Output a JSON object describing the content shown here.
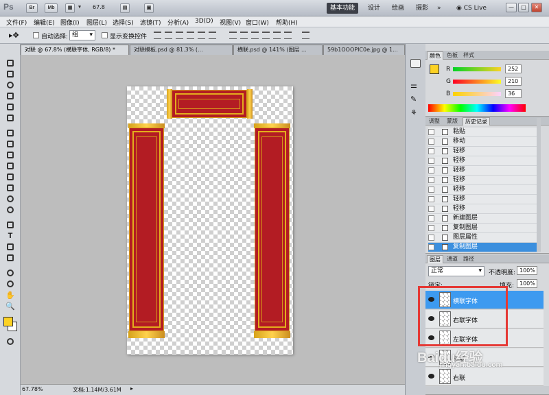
{
  "app": {
    "logo": "Ps",
    "buttons": [
      "Br",
      "Mb"
    ],
    "zoom": "67.8",
    "workspaces": [
      "基本功能",
      "设计",
      "绘画",
      "摄影"
    ],
    "active_workspace": "基本功能",
    "more": "»",
    "cs_live": "CS Live",
    "window_controls": [
      "—",
      "□",
      "✕"
    ]
  },
  "menu": [
    "文件(F)",
    "编辑(E)",
    "图像(I)",
    "图层(L)",
    "选择(S)",
    "滤镜(T)",
    "分析(A)",
    "3D(D)",
    "视图(V)",
    "窗口(W)",
    "帮助(H)"
  ],
  "options": {
    "auto_select_label": "自动选择:",
    "auto_select_value": "组",
    "show_transform_label": "显示变换控件"
  },
  "tabs": [
    "对联 @ 67.8% (横联字体, RGB/8) *",
    "对联模板.psd @ 81.3% (...",
    "横联.psd @ 141% (图层 ...",
    "59b1OOOPIC0e.jpg @ 1..."
  ],
  "status": {
    "zoom": "67.78%",
    "doc": "文档:1.14M/3.61M"
  },
  "color_panel": {
    "tabs": [
      "颜色",
      "色板",
      "样式"
    ],
    "r_label": "R",
    "r_value": "252",
    "g_label": "G",
    "g_value": "210",
    "b_label": "B",
    "b_value": "36",
    "foreground": "#fcd224",
    "r": 0.988,
    "g": 0.824,
    "b": 0.141
  },
  "history_panel": {
    "tabs": [
      "调整",
      "蒙版",
      "历史记录"
    ],
    "items": [
      "粘贴",
      "移动",
      "轻移",
      "轻移",
      "轻移",
      "轻移",
      "轻移",
      "轻移",
      "轻移",
      "新建图层",
      "复制图层",
      "图层属性",
      "复制图层"
    ]
  },
  "layers_panel": {
    "tabs": [
      "图层",
      "通道",
      "路径"
    ],
    "blend_mode": "正常",
    "opacity_label": "不透明度:",
    "opacity_value": "100%",
    "lock_label": "锁定:",
    "fill_label": "填充:",
    "fill_value": "100%",
    "layers": [
      "横联字体",
      "右联字体",
      "左联字体",
      "横联",
      "右联"
    ]
  },
  "watermark": {
    "brand": "Baidu经验",
    "url": "jingyan.baidu.com"
  }
}
